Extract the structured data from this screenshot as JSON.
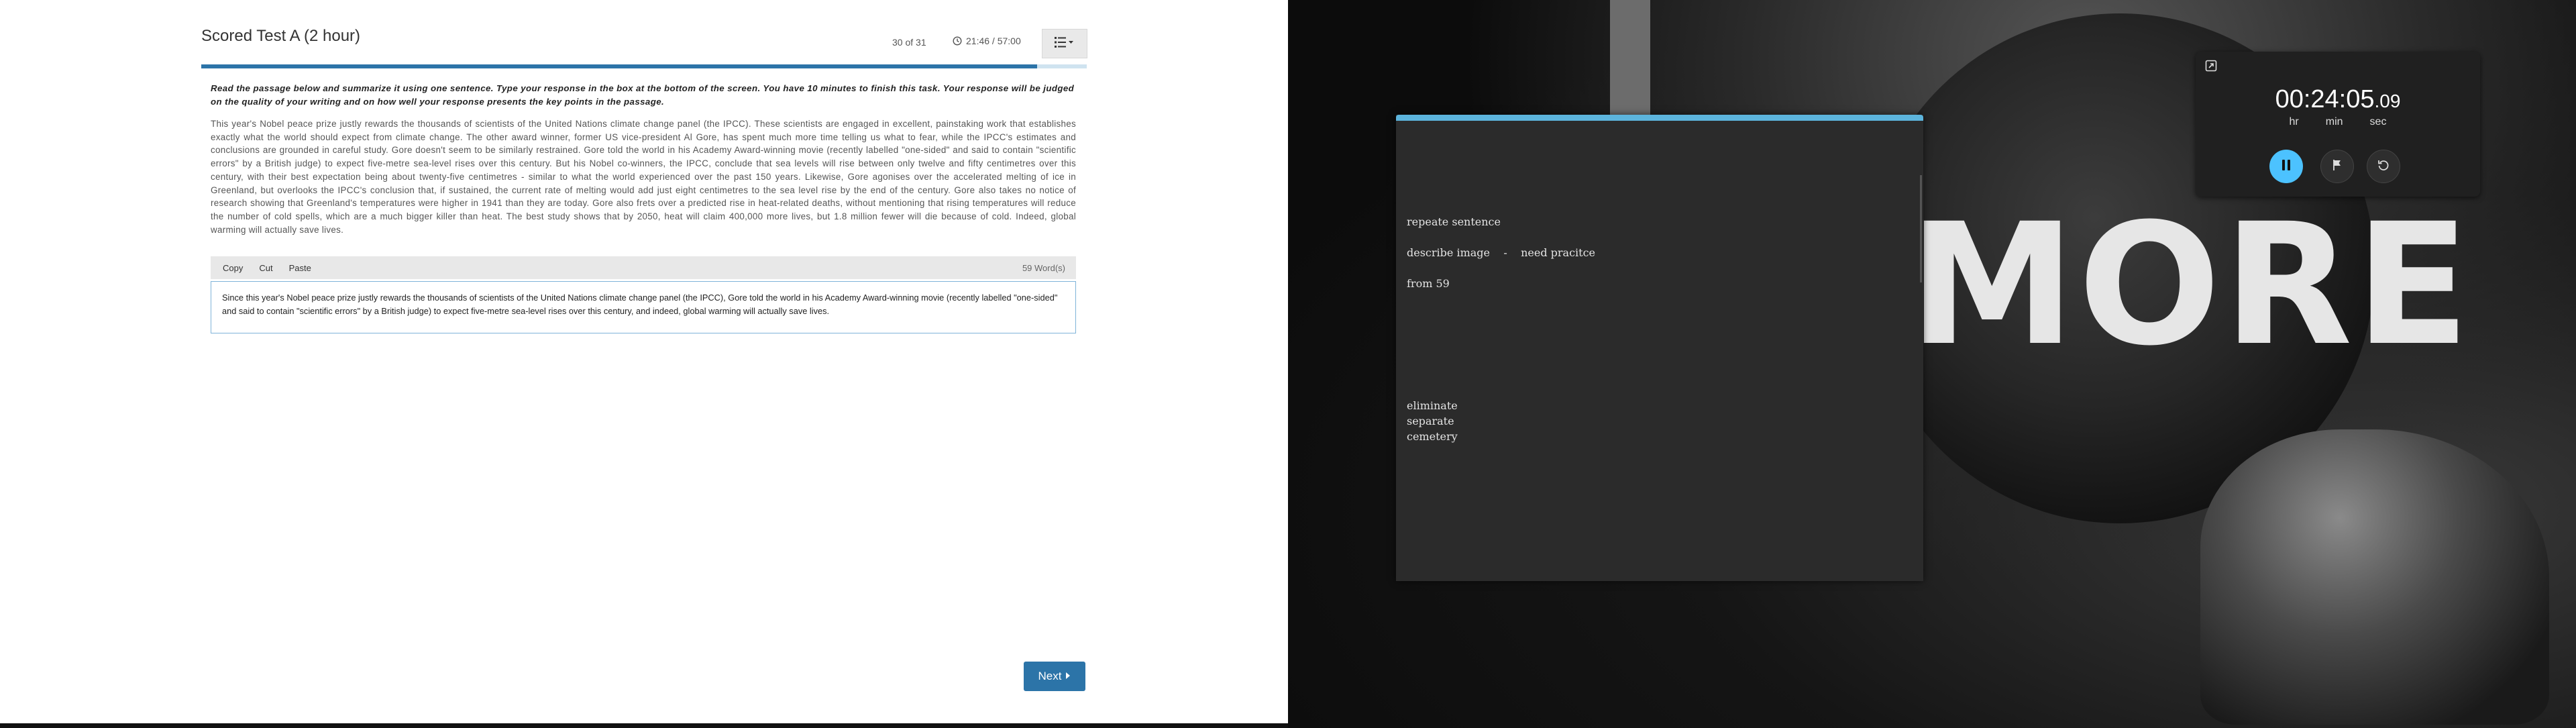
{
  "test": {
    "title": "Scored Test A (2 hour)",
    "counter": "30 of 31",
    "timer": "21:46 / 57:00",
    "progress_fraction": 0.944,
    "instructions": "Read the passage below and summarize it using one sentence. Type your response in the box at the bottom of the screen. You have 10 minutes to finish this task. Your response will be judged on the quality of your writing and on how well your response presents the key points in the passage.",
    "passage": "This year's Nobel peace prize justly rewards the thousands of scientists of the United Nations climate change panel (the IPCC). These scientists are engaged in excellent, painstaking work that establishes exactly what the world should expect from climate change. The other award winner, former US vice-president Al Gore, has spent much more time telling us what to fear, while the IPCC's estimates and conclusions are grounded in careful study. Gore doesn't seem to be similarly restrained. Gore told the world in his Academy Award-winning movie (recently labelled \"one-sided\" and said to contain \"scientific errors\" by a British judge) to expect five-metre sea-level rises over this century. But his Nobel co-winners, the IPCC, conclude that sea levels will rise between only twelve and fifty centimetres over this century, with their best expectation being about twenty-five centimetres - similar to what the world experienced over the past 150 years. Likewise, Gore agonises over the accelerated melting of ice in Greenland, but overlooks the IPCC's conclusion that, if sustained, the current rate of melting would add just eight centimetres to the sea level rise by the end of the century. Gore also takes no notice of research showing that Greenland's temperatures were higher in 1941 than they are today. Gore also frets over a predicted rise in heat-related deaths, without mentioning that rising temperatures will reduce the number of cold spells, which are a much bigger killer than heat. The best study shows that by 2050, heat will claim 400,000 more lives, but 1.8 million fewer will die because of cold. Indeed, global warming will actually save lives.",
    "toolbar": {
      "copy": "Copy",
      "cut": "Cut",
      "paste": "Paste",
      "word_count": "59 Word(s)"
    },
    "answer": "Since this year's Nobel peace prize justly rewards the thousands of scientists of the United Nations climate change panel (the IPCC), Gore told the world in his Academy Award-winning movie (recently labelled \"one-sided\" and said to contain \"scientific errors\" by a British judge) to expect five-metre sea-level rises over this century, and indeed, global warming will actually save lives.",
    "next_label": "Next",
    "accent_color": "#2c74a8"
  },
  "background": {
    "text": "MORE"
  },
  "notes": {
    "line1": "repeate sentence",
    "line2": "describe image    -    need pracitce",
    "line3": "from 59",
    "line4": "eliminate",
    "line5": "separate",
    "line6": "cemetery",
    "accent_color": "#5cb4dc"
  },
  "stopwatch": {
    "time_main": "00:24:05",
    "time_frac": ".09",
    "unit_hr": "hr",
    "unit_min": "min",
    "unit_sec": "sec",
    "accent_color": "#4cc2ff"
  }
}
